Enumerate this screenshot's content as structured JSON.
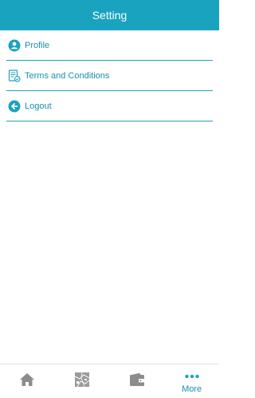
{
  "header": {
    "title": "Setting"
  },
  "menu": {
    "items": [
      {
        "label": "Profile",
        "icon": "profile-icon"
      },
      {
        "label": "Terms and Conditions",
        "icon": "document-icon"
      },
      {
        "label": "Logout",
        "icon": "logout-icon"
      }
    ]
  },
  "tabbar": {
    "tabs": [
      {
        "icon": "home-icon",
        "label": ""
      },
      {
        "icon": "map-icon",
        "label": ""
      },
      {
        "icon": "wallet-icon",
        "label": ""
      },
      {
        "icon": "more-icon",
        "label": "More"
      }
    ]
  },
  "colors": {
    "accent": "#1aa3bf",
    "text": "#1891ab",
    "inactive_icon": "#8c8c8c"
  }
}
